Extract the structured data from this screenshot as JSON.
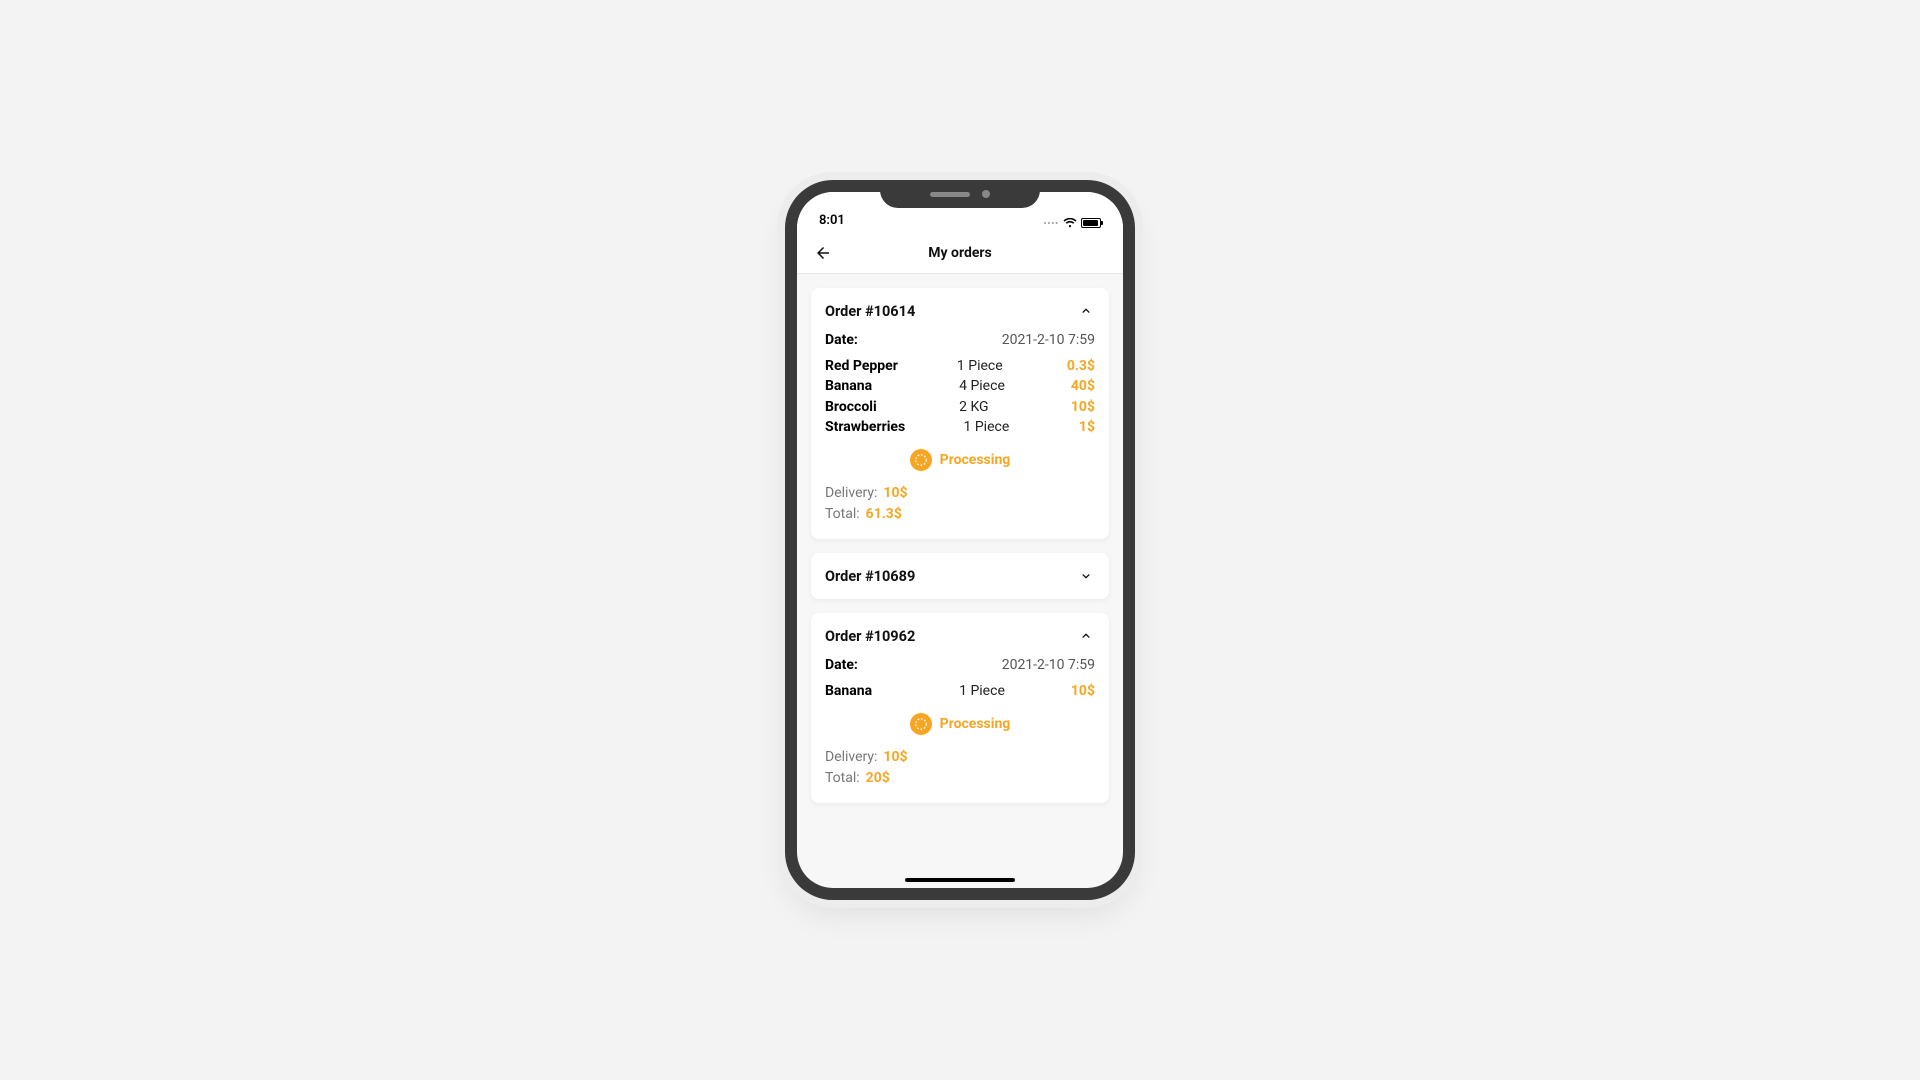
{
  "status_bar": {
    "time": "8:01"
  },
  "nav": {
    "title": "My orders"
  },
  "labels": {
    "date": "Date:",
    "delivery": "Delivery:",
    "total": "Total:"
  },
  "orders": [
    {
      "title": "Order #10614",
      "expanded": true,
      "date": "2021-2-10 7:59",
      "items": [
        {
          "name": "Red Pepper",
          "qty": "1 Piece",
          "price": "0.3$"
        },
        {
          "name": "Banana",
          "qty": "4 Piece",
          "price": "40$"
        },
        {
          "name": "Broccoli",
          "qty": "2 KG",
          "price": "10$"
        },
        {
          "name": "Strawberries",
          "qty": "1 Piece",
          "price": "1$"
        }
      ],
      "status": "Processing",
      "delivery": "10$",
      "total": "61.3$"
    },
    {
      "title": "Order #10689",
      "expanded": false
    },
    {
      "title": "Order #10962",
      "expanded": true,
      "date": "2021-2-10 7:59",
      "items": [
        {
          "name": "Banana",
          "qty": "1 Piece",
          "price": "10$"
        }
      ],
      "status": "Processing",
      "delivery": "10$",
      "total": "20$"
    }
  ]
}
